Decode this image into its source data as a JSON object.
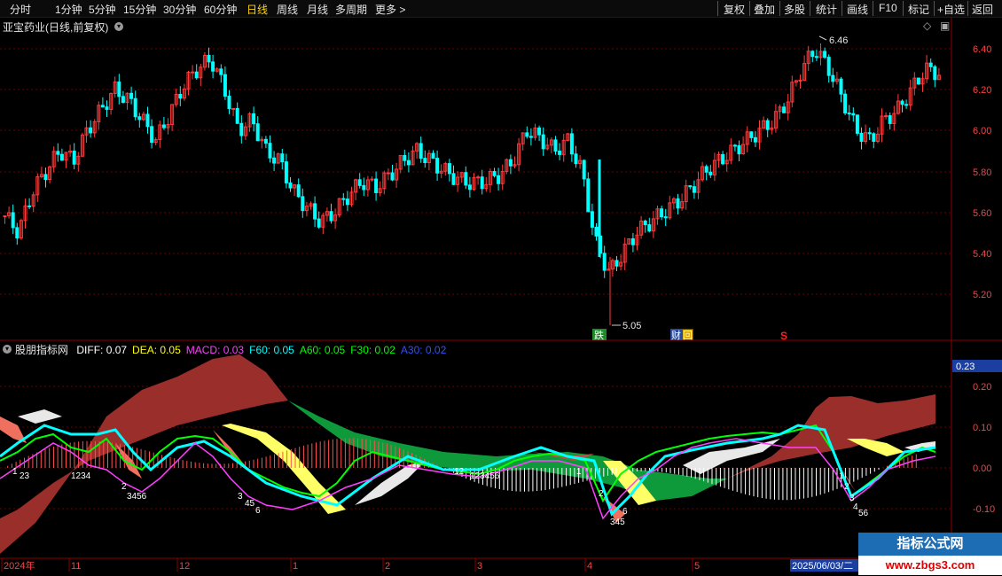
{
  "toolbar": {
    "left_items": [
      "分时",
      "1分钟",
      "5分钟",
      "15分钟",
      "30分钟",
      "60分钟",
      "日线",
      "周线",
      "月线",
      "多周期",
      "更多 >"
    ],
    "active_index": 6,
    "right_items": [
      "复权",
      "叠加",
      "多股",
      "统计",
      "画线",
      "F10",
      "+自选",
      "返回"
    ],
    "extra_right": "标记"
  },
  "main_chart": {
    "title": "亚宝药业(日线,前复权)",
    "y_ticks": [
      "6.40",
      "6.20",
      "6.00",
      "5.80",
      "5.60",
      "5.40",
      "5.20"
    ],
    "high_label": "6.46",
    "low_label": "5.05",
    "markers": [
      "跌",
      "财",
      "回",
      "S"
    ]
  },
  "indicator": {
    "name": "股朋指标网",
    "legend": [
      {
        "key": "DIFF",
        "value": "0.07",
        "color": "#ffffff"
      },
      {
        "key": "DEA",
        "value": "0.05",
        "color": "#ffff00"
      },
      {
        "key": "MACD",
        "value": "0.03",
        "color": "#ff40ff"
      },
      {
        "key": "F60",
        "value": "0.05",
        "color": "#00ffff"
      },
      {
        "key": "A60",
        "value": "0.05",
        "color": "#00ff00"
      },
      {
        "key": "F30",
        "value": "0.02",
        "color": "#00ff00"
      },
      {
        "key": "A30",
        "value": "0.02",
        "color": "#3050ff"
      }
    ],
    "current_value": "0.23",
    "y_ticks": [
      "0.20",
      "0.10",
      "0.00",
      "-0.10"
    ],
    "digit_labels": [
      "1",
      "23",
      "1234",
      "2",
      "3456",
      "3",
      "45",
      "6",
      "12",
      "123456",
      "1",
      "2",
      "345",
      "6",
      "1",
      "2",
      "3",
      "4",
      "56"
    ]
  },
  "time_axis": {
    "labels": [
      "2024年",
      "11",
      "12",
      "1",
      "2",
      "3",
      "4",
      "5"
    ],
    "cursor_date": "2025/06/03/二"
  },
  "watermark": {
    "title": "指标公式网",
    "url": "www.zbgs3.com"
  },
  "colors": {
    "up": "#ff3b3b",
    "down": "#00ffff",
    "grid": "#8b0000",
    "axis_text": "#ff4040"
  }
}
